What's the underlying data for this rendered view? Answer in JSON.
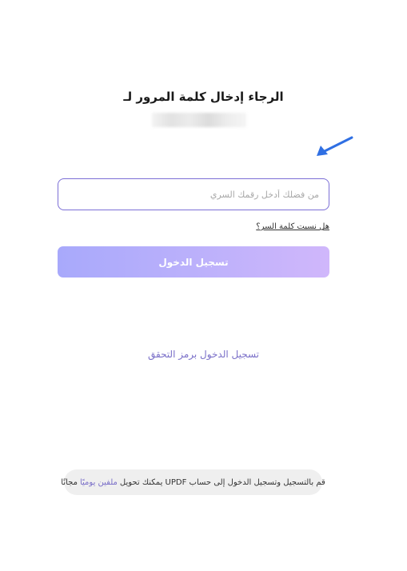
{
  "header": {
    "title": "الرجاء إدخال كلمة المرور لـ"
  },
  "password": {
    "placeholder": "من فضلك أدخل رقمك السري"
  },
  "links": {
    "forgot_password": "هل نسيت كلمة السر؟",
    "code_login": "تسجيل الدخول برمز التحقق"
  },
  "buttons": {
    "login": "تسجيل الدخول"
  },
  "footer": {
    "text_before": "قم بالتسجيل وتسجيل الدخول إلى حساب UPDF يمكنك تحويل",
    "highlight": "ملفين يوميًا",
    "text_after": "مجانًا"
  },
  "colors": {
    "accent": "#7c6fd6",
    "arrow": "#2f6fe3",
    "button_start": "#a8a9fb",
    "button_end": "#d0b7fb",
    "link": "#7a6fc8",
    "footer_bg": "#efefef"
  },
  "icons": {
    "pointer": "arrow-pointer-icon"
  }
}
